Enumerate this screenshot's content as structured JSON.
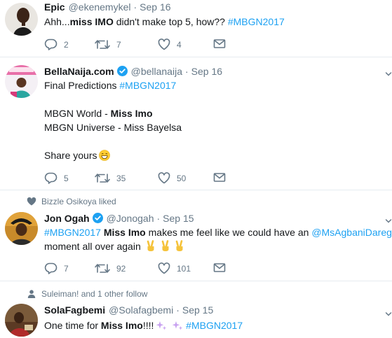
{
  "tweets": [
    {
      "name": "Epic",
      "handle": "@ekenemykel",
      "dot": "·",
      "date": "Sep 16",
      "text": {
        "a": "Ahh...",
        "b": "miss IMO",
        "c": " didn't make top 5, how?? ",
        "tag": "#MBGN2017"
      },
      "replies": "2",
      "retweets": "7",
      "likes": "4"
    },
    {
      "name": "BellaNaija.com",
      "handle": "@bellanaija",
      "dot": "·",
      "date": "Sep 16",
      "text": {
        "l1a": "Final Predictions ",
        "l1tag": "#MBGN2017",
        "l2a": "MBGN World - ",
        "l2b": "Miss Imo",
        "l3": "MBGN Universe - Miss Bayelsa",
        "l4": "Share yours"
      },
      "replies": "5",
      "retweets": "35",
      "likes": "50"
    },
    {
      "context": "Bizzle Osikoya liked",
      "name": "Jon Ogah",
      "handle": "@Jonogah",
      "dot": "·",
      "date": "Sep 15",
      "text": {
        "tag": "#MBGN2017",
        "b": "Miss Imo",
        "a": " makes me feel like we could have an ",
        "mention": "@MsAgbaniDarego",
        "l2": "moment all over again"
      },
      "replies": "7",
      "retweets": "92",
      "likes": "101"
    },
    {
      "context": "Suleiman! and 1 other follow",
      "name": "SolaFagbemi",
      "handle": "@Solafagbemi",
      "dot": "·",
      "date": "Sep 15",
      "text": {
        "a": "One time for ",
        "b": "Miss Imo",
        "c": "!!!!",
        "tag": "#MBGN2017"
      }
    }
  ],
  "icons": {
    "reply": "reply-icon",
    "retweet": "retweet-icon",
    "like": "heart-icon",
    "dm": "envelope-icon",
    "verified": "verified-badge-icon",
    "caret": "chevron-down-icon"
  },
  "colors": {
    "link": "#1da1f2",
    "muted": "#657786",
    "divider": "#e6ecf0",
    "text": "#14171a"
  }
}
